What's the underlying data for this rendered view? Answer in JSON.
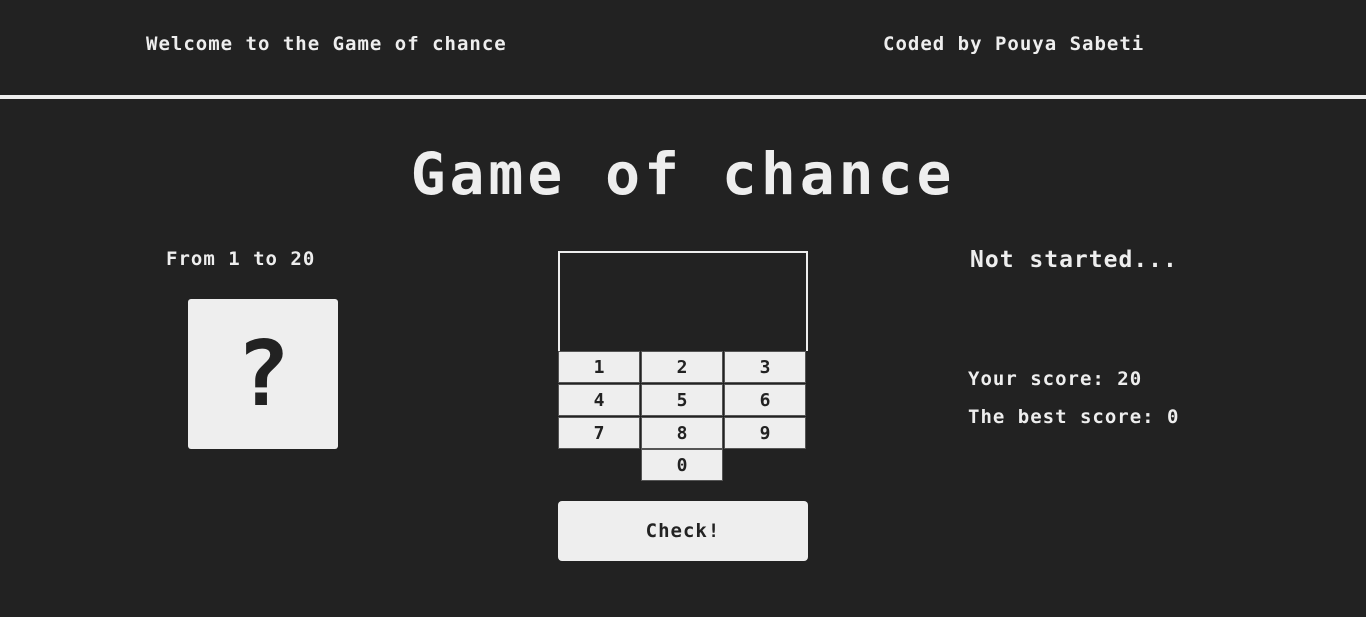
{
  "header": {
    "welcome": "Welcome to the Game of chance",
    "credit": "Coded by Pouya Sabeti"
  },
  "game": {
    "title": "Game of chance",
    "range_label": "From 1 to 20",
    "secret_placeholder": "?",
    "guess_value": "",
    "keys": [
      "1",
      "2",
      "3",
      "4",
      "5",
      "6",
      "7",
      "8",
      "9",
      "0"
    ],
    "check_label": "Check!",
    "status": "Not started...",
    "score_label": "Your score: ",
    "score": "20",
    "best_label": "The best score: ",
    "best_score": "0"
  },
  "colors": {
    "background": "#222222",
    "foreground": "#eeeeee"
  }
}
